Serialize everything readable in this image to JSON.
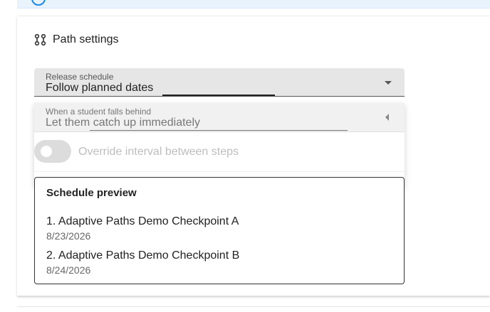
{
  "section": {
    "title": "Path settings",
    "icon": "path-nodes-icon"
  },
  "release_schedule": {
    "label": "Release schedule",
    "value": "Follow planned dates"
  },
  "falls_behind": {
    "label": "When a student falls behind",
    "value": "Let them catch up immediately"
  },
  "override_interval": {
    "label": "Override interval between steps",
    "enabled": false
  },
  "preview": {
    "title": "Schedule preview",
    "items": [
      {
        "title": "1. Adaptive Paths Demo Checkpoint A",
        "date": "8/23/2026"
      },
      {
        "title": "2. Adaptive Paths Demo Checkpoint B",
        "date": "8/24/2026"
      }
    ]
  },
  "colors": {
    "banner": "#e8f3fc",
    "accent": "#1e88e5",
    "field_bg": "#e6e6e6"
  }
}
